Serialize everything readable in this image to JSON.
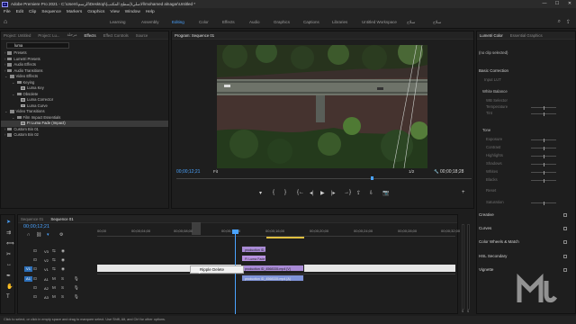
{
  "titlebar": {
    "title": "Adobe Premiere Pro 2021 - C:\\Users\\الرسم\\Desktop\\الاصلي\\(سطح المكتب)\\mohamed alnagar\\Untitled *",
    "minimize": "—",
    "maximize": "☐",
    "close": "✕"
  },
  "menu": [
    "File",
    "Edit",
    "Clip",
    "Sequence",
    "Markers",
    "Graphics",
    "View",
    "Window",
    "Help"
  ],
  "workspaces": {
    "tabs": [
      "Learning",
      "Assembly",
      "Editing",
      "Color",
      "Effects",
      "Audio",
      "Graphics",
      "Captions",
      "Libraries",
      "Untitled Workspace",
      "سلاح",
      "سلاح"
    ],
    "active_index": 2
  },
  "project_panel": {
    "tabs": [
      "Project: Untitled",
      "Project: Lu...",
      "مرحلة",
      "Effects",
      "Effect Controls",
      "Source"
    ],
    "active_tab_index": 3,
    "search_value": "luma",
    "tree": [
      {
        "label": "Presets",
        "level": 0,
        "kind": "folder"
      },
      {
        "label": "Lumetri Presets",
        "level": 0,
        "kind": "folder"
      },
      {
        "label": "Audio Effects",
        "level": 0,
        "kind": "folder"
      },
      {
        "label": "Audio Transitions",
        "level": 0,
        "kind": "folder"
      },
      {
        "label": "Video Effects",
        "level": 0,
        "kind": "folder",
        "open": true
      },
      {
        "label": "Keying",
        "level": 1,
        "kind": "folder",
        "open": true
      },
      {
        "label": "Luma Key",
        "level": 2,
        "kind": "fx"
      },
      {
        "label": "Obsolete",
        "level": 1,
        "kind": "folder",
        "open": true
      },
      {
        "label": "Luma Corrector",
        "level": 2,
        "kind": "fx"
      },
      {
        "label": "Luma Curve",
        "level": 2,
        "kind": "fx"
      },
      {
        "label": "Video Transitions",
        "level": 0,
        "kind": "folder",
        "open": true
      },
      {
        "label": "Film Impact Essentials",
        "level": 1,
        "kind": "folder",
        "open": true
      },
      {
        "label": "FI Luma Fade (Impact)",
        "level": 2,
        "kind": "fx",
        "selected": true
      },
      {
        "label": "Custom Bin 01",
        "level": 0,
        "kind": "folder"
      },
      {
        "label": "Custom Bin 02",
        "level": 0,
        "kind": "folder"
      }
    ]
  },
  "program_monitor": {
    "tab": "Program: Sequence 01",
    "timecode": "00;00;12;21",
    "fit": "Fit",
    "quality": "1/2",
    "duration": "00;00;18;28",
    "buttons": {
      "marker": "▾",
      "in": "{",
      "out": "}",
      "go_in": "{←",
      "step_back": "◂|",
      "play": "▶",
      "step_fwd": "|▸",
      "go_out": "→}",
      "lift": "⇪",
      "extract": "⇩",
      "export_frame": "📷",
      "add": "+"
    }
  },
  "lumetri": {
    "tabs": [
      "Lumetri Color",
      "Essential Graphics"
    ],
    "active_tab_index": 0,
    "clip_selector": "(no clip selected)",
    "sections": [
      "Basic Correction",
      "Creative",
      "Curves",
      "Color Wheels & Match",
      "HSL Secondary",
      "Vignette"
    ],
    "basic_rows": [
      "Input LUT",
      "White Balance",
      "WB Selector",
      "Temperature",
      "Tint",
      "Tone",
      "Exposure",
      "Contrast",
      "Highlights",
      "Shadows",
      "Whites",
      "Blacks",
      "Reset",
      "Saturation"
    ]
  },
  "timeline": {
    "tabs": [
      "Sequence 01",
      "Sequence 01"
    ],
    "active_tab_index": 1,
    "timecode": "00;00;12;21",
    "ruler": [
      "00;00",
      "00;00;04;00",
      "00;00;08;00",
      "00;00;12;00",
      "00;00;16;00",
      "00;00;20;00",
      "00;00;24;00",
      "00;00;28;00",
      "00;00;32;00"
    ],
    "tracks": [
      {
        "name": "V3",
        "lock": "🔒"
      },
      {
        "name": "V2",
        "lock": "🔒"
      },
      {
        "name": "V1",
        "lock": "🔒"
      },
      {
        "name": "A1",
        "lock": "🔒",
        "tag": "M",
        "solo": "S"
      },
      {
        "name": "A2",
        "lock": "🔒",
        "tag": "M",
        "solo": "S"
      },
      {
        "name": "A3",
        "lock": "🔒",
        "tag": "M",
        "solo": "S"
      }
    ],
    "clips": [
      {
        "label": "production ID_4...",
        "track": "V3"
      },
      {
        "label": "FI Luma Fade (Imp...",
        "track": "V2"
      },
      {
        "label": "production ID_4568335.mp4 [V]",
        "track": "V1"
      },
      {
        "label": "production ID_4568335.mp4 [A]",
        "track": "A1"
      }
    ],
    "context_menu": "Ripple Delete",
    "meter_labels": [
      "S",
      "S"
    ]
  },
  "status": "Click to select, or click in empty space and drag to marquee select. Use Shift, Alt, and Ctrl for other options.",
  "watermark": "M",
  "colors": {
    "accent": "#4aa3ff",
    "video_clip": "#a98bd6",
    "audio_clip": "#7f93d8"
  }
}
